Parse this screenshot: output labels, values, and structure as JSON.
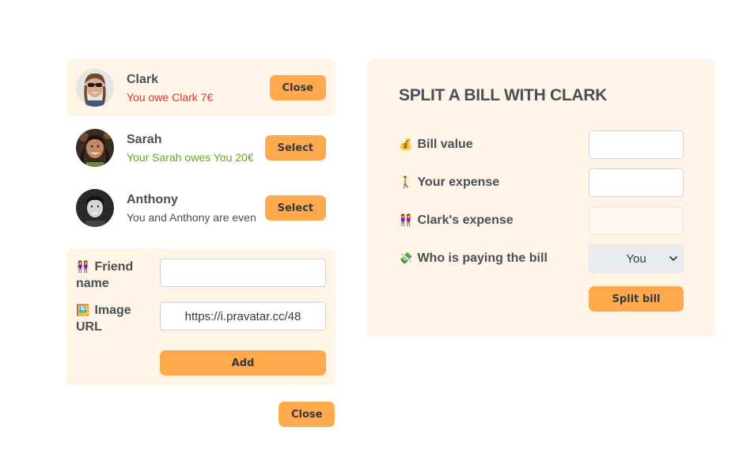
{
  "friends": [
    {
      "name": "Clark",
      "balance": "You owe Clark 7€",
      "button": "Close",
      "selected": true,
      "status": "owe"
    },
    {
      "name": "Sarah",
      "balance": "Your Sarah owes You 20€",
      "button": "Select",
      "selected": false,
      "status": "owed"
    },
    {
      "name": "Anthony",
      "balance": "You and Anthony are even",
      "button": "Select",
      "selected": false,
      "status": "even"
    }
  ],
  "add_form": {
    "friend_name_label": "Friend name",
    "friend_name_value": "",
    "image_url_label": "Image URL",
    "image_url_value": "https://i.pravatar.cc/48",
    "add_button": "Add"
  },
  "close_button": "Close",
  "split": {
    "title": "SPLIT A BILL WITH CLARK",
    "bill_value_label": "Bill value",
    "bill_value": "",
    "your_expense_label": "Your expense",
    "your_expense": "",
    "friend_expense_label": "Clark's expense",
    "friend_expense": "",
    "payer_label": "Who is paying the bill",
    "payer_selected": "You",
    "split_button": "Split bill"
  },
  "colors": {
    "accent": "#ffa94d",
    "panel": "#fff4e6",
    "red": "#e03131",
    "green": "#66a80f"
  },
  "icons": {
    "bill": "money-bag-icon",
    "expense": "person-walking-icon",
    "friend_expense": "two-women-icon",
    "payer": "money-wings-icon",
    "friend_name": "two-women-icon",
    "image_url": "framed-picture-icon"
  }
}
